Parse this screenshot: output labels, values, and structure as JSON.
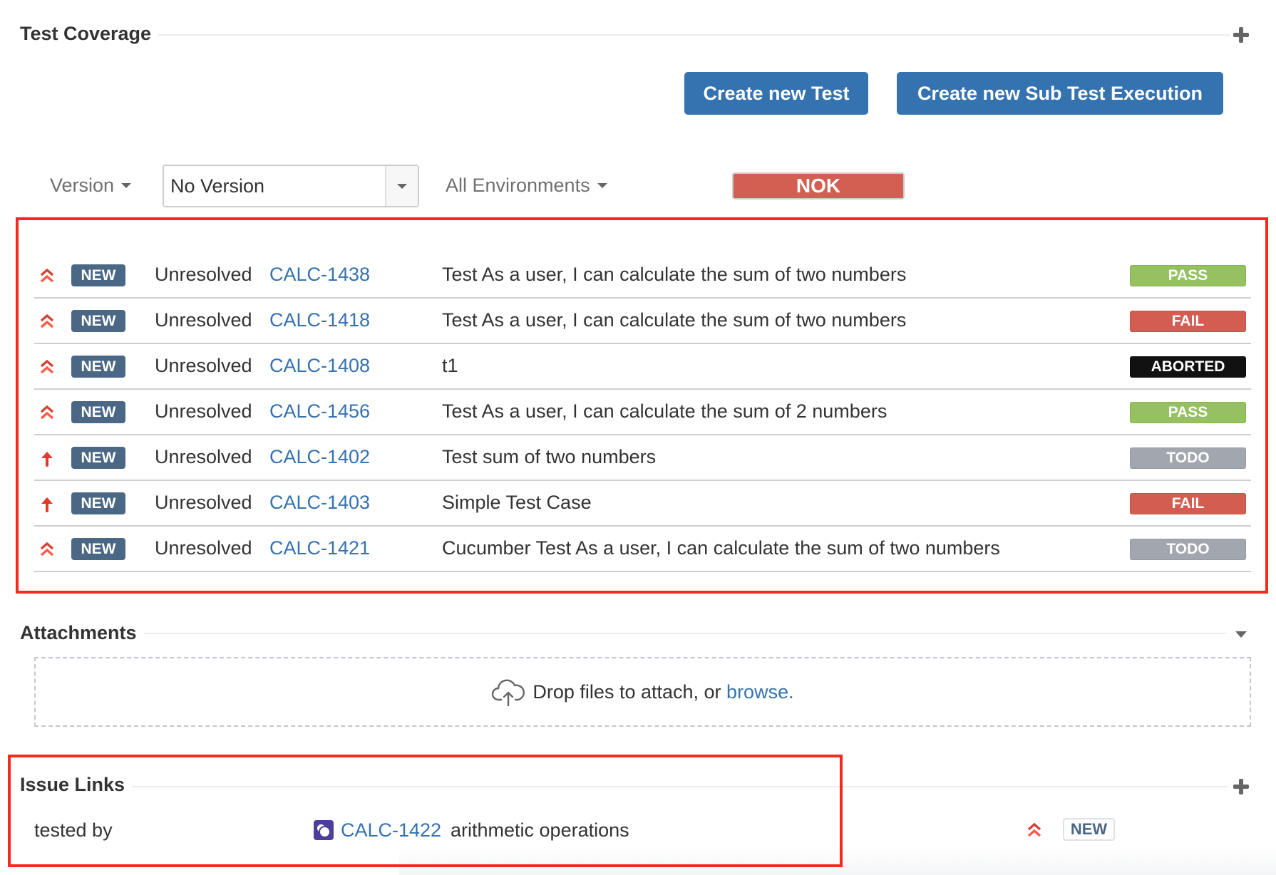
{
  "test_coverage": {
    "title": "Test Coverage",
    "add_icon": "plus-icon",
    "buttons": {
      "create_test": "Create new Test",
      "create_sub_execution": "Create new Sub Test Execution"
    },
    "filters": {
      "version_label": "Version",
      "version_value": "No Version",
      "environment_label": "All Environments",
      "overall_status": "NOK",
      "overall_status_color": "#d35f52"
    },
    "rows": [
      {
        "priority": "highest",
        "priority_icon": "double-chevron-up-icon",
        "status": "NEW",
        "resolution": "Unresolved",
        "key": "CALC-1438",
        "summary": "Test As a user, I can calculate the sum of two numbers",
        "result": "PASS",
        "result_color": "#95c160"
      },
      {
        "priority": "highest",
        "priority_icon": "double-chevron-up-icon",
        "status": "NEW",
        "resolution": "Unresolved",
        "key": "CALC-1418",
        "summary": "Test As a user, I can calculate the sum of two numbers",
        "result": "FAIL",
        "result_color": "#d45d52"
      },
      {
        "priority": "highest",
        "priority_icon": "double-chevron-up-icon",
        "status": "NEW",
        "resolution": "Unresolved",
        "key": "CALC-1408",
        "summary": "t1",
        "result": "ABORTED",
        "result_color": "#111111"
      },
      {
        "priority": "highest",
        "priority_icon": "double-chevron-up-icon",
        "status": "NEW",
        "resolution": "Unresolved",
        "key": "CALC-1456",
        "summary": "Test As a user, I can calculate the sum of 2 numbers",
        "result": "PASS",
        "result_color": "#95c160"
      },
      {
        "priority": "high",
        "priority_icon": "arrow-up-icon",
        "status": "NEW",
        "resolution": "Unresolved",
        "key": "CALC-1402",
        "summary": "Test sum of two numbers",
        "result": "TODO",
        "result_color": "#a2a6ae"
      },
      {
        "priority": "high",
        "priority_icon": "arrow-up-icon",
        "status": "NEW",
        "resolution": "Unresolved",
        "key": "CALC-1403",
        "summary": "Simple Test Case",
        "result": "FAIL",
        "result_color": "#d45d52"
      },
      {
        "priority": "highest",
        "priority_icon": "double-chevron-up-icon",
        "status": "NEW",
        "resolution": "Unresolved",
        "key": "CALC-1421",
        "summary": "Cucumber Test As a user, I can calculate the sum of two numbers",
        "result": "TODO",
        "result_color": "#a2a6ae"
      }
    ]
  },
  "attachments": {
    "title": "Attachments",
    "drop_text": "Drop files to attach, or",
    "browse_label": "browse."
  },
  "issue_links": {
    "title": "Issue Links",
    "links": [
      {
        "relation": "tested by",
        "key": "CALC-1422",
        "summary": "arithmetic operations",
        "priority": "highest",
        "status": "NEW"
      }
    ]
  },
  "colors": {
    "primary_button": "#3572b0",
    "link": "#3572b0",
    "highlight_border": "#f5291c",
    "new_badge": "#4a6785"
  }
}
